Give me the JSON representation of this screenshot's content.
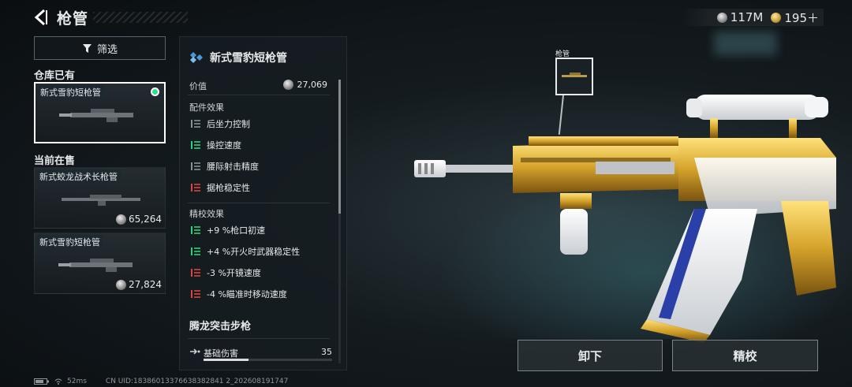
{
  "header": {
    "title": "枪管",
    "currency": [
      {
        "icon": "silver-coin-icon",
        "amount": "117M"
      },
      {
        "icon": "gold-coin-icon",
        "amount": "195＋"
      }
    ]
  },
  "filter": {
    "label": "筛选"
  },
  "inventory": {
    "owned_label": "仓库已有",
    "owned": [
      {
        "name": "新式雪豹短枪管"
      }
    ],
    "sale_label": "当前在售",
    "sale": [
      {
        "name": "新式蛟龙战术长枪管",
        "price": "65,264"
      },
      {
        "name": "新式雪豹短枪管",
        "price": "27,824"
      }
    ]
  },
  "detail": {
    "title": "新式雪豹短枪管",
    "value_label": "价值",
    "value": "27,069",
    "effects_label": "配件效果",
    "effects": [
      {
        "label": "后坐力控制",
        "tone": "neutral"
      },
      {
        "label": "操控速度",
        "tone": "positive"
      },
      {
        "label": "腰际射击精度",
        "tone": "neutral"
      },
      {
        "label": "据枪稳定性",
        "tone": "negative"
      }
    ],
    "tuning_label": "精校效果",
    "tuning": [
      {
        "label": "+9 %枪口初速",
        "tone": "positive"
      },
      {
        "label": "+4 %开火时武器稳定性",
        "tone": "positive"
      },
      {
        "label": "-3 %开镜速度",
        "tone": "negative"
      },
      {
        "label": "-4 %瞄准时移动速度",
        "tone": "negative"
      }
    ],
    "weapon_name": "腾龙突击步枪",
    "stat": {
      "label": "基础伤害",
      "value": "35",
      "fill": 0.35
    }
  },
  "slot": {
    "label": "枪管"
  },
  "actions": {
    "unequip": "卸下",
    "tune": "精校"
  },
  "footer": {
    "ping": "52ms",
    "uid": "CN UID:18386013376638382841 2_202608191747"
  },
  "colors": {
    "positive": "#2fd07a",
    "negative": "#e0423f",
    "neutral": "#8a9297",
    "selected": "#2fe08a"
  }
}
